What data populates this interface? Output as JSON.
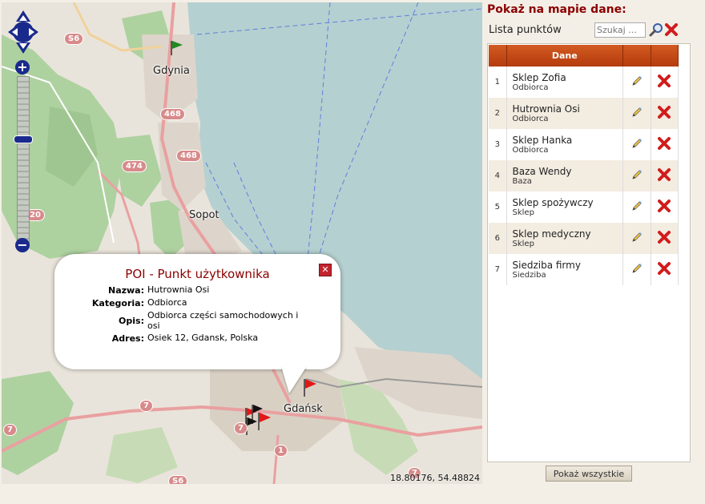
{
  "panel": {
    "title": "Pokaż na mapie dane:",
    "list_label": "Lista punktów",
    "search_placeholder": "Szukaj ...",
    "table_header": "Dane",
    "show_all_button": "Pokaż wszystkie",
    "rows": [
      {
        "num": "1",
        "name": "Sklep Zofia",
        "category": "Odbiorca"
      },
      {
        "num": "2",
        "name": "Hutrownia Osi",
        "category": "Odbiorca"
      },
      {
        "num": "3",
        "name": "Sklep Hanka",
        "category": "Odbiorca"
      },
      {
        "num": "4",
        "name": "Baza Wendy",
        "category": "Baza"
      },
      {
        "num": "5",
        "name": "Sklep spożywczy",
        "category": "Sklep"
      },
      {
        "num": "6",
        "name": "Sklep medyczny",
        "category": "Sklep"
      },
      {
        "num": "7",
        "name": "Siedziba firmy",
        "category": "Siedziba"
      }
    ]
  },
  "popup": {
    "title": "POI - Punkt użytkownika",
    "fields": [
      {
        "label": "Nazwa:",
        "value": "Hutrownia Osi"
      },
      {
        "label": "Kategoria:",
        "value": "Odbiorca"
      },
      {
        "label": "Opis:",
        "value": "Odbiorca części samochodowych i osi"
      },
      {
        "label": "Adres:",
        "value": "Osiek 12, Gdansk, Polska"
      }
    ]
  },
  "map": {
    "places": {
      "gdynia": "Gdynia",
      "sopot": "Sopot",
      "gdansk": "Gdańsk"
    },
    "road_shields": {
      "s6_top": "S6",
      "r468a": "468",
      "r468b": "468",
      "r474": "474",
      "r20": "20",
      "r7a": "7",
      "r7b": "7",
      "r7c": "7",
      "r1": "1",
      "s6_bottom": "S6",
      "r7d": "7"
    },
    "coordinates": "18.80176, 54.48824",
    "colors": {
      "sea": "#b5d0d0",
      "land": "#e9e4db",
      "forest": "#aed1a0",
      "urban": "#ddd5cb",
      "road": "#e9a0a0"
    }
  }
}
